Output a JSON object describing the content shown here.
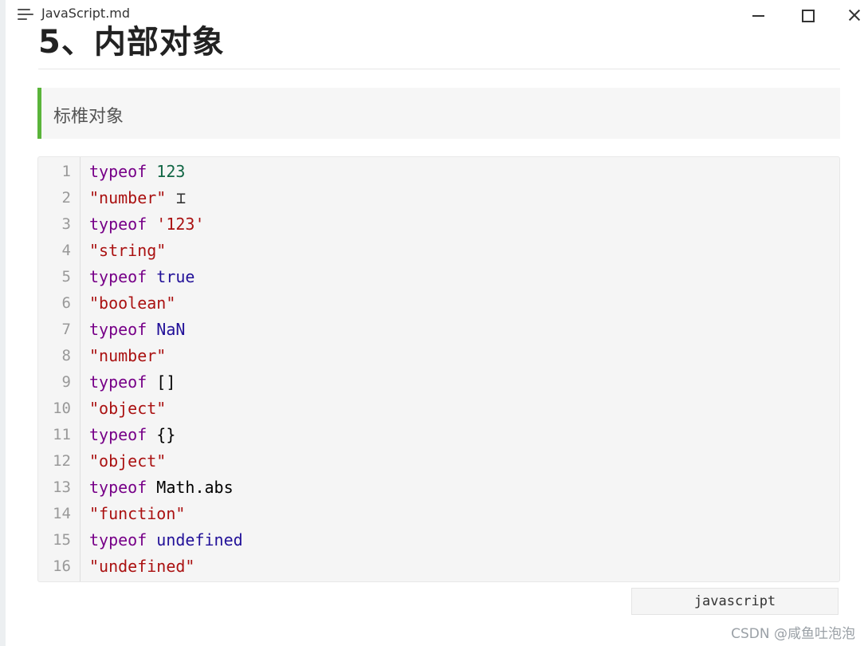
{
  "window": {
    "file_title": "JavaScript.md"
  },
  "document": {
    "heading": "5、内部对象",
    "blockquote": "标椎对象",
    "code_language": "javascript",
    "code_lines": [
      {
        "num": "1",
        "tokens": [
          {
            "t": "typeof",
            "c": "kw"
          },
          {
            "t": " "
          },
          {
            "t": "123",
            "c": "num"
          }
        ]
      },
      {
        "num": "2",
        "tokens": [
          {
            "t": "\"number\"",
            "c": "str"
          }
        ]
      },
      {
        "num": "3",
        "tokens": [
          {
            "t": "typeof",
            "c": "kw"
          },
          {
            "t": " "
          },
          {
            "t": "'123'",
            "c": "str"
          }
        ]
      },
      {
        "num": "4",
        "tokens": [
          {
            "t": "\"string\"",
            "c": "str"
          }
        ]
      },
      {
        "num": "5",
        "tokens": [
          {
            "t": "typeof",
            "c": "kw"
          },
          {
            "t": " "
          },
          {
            "t": "true",
            "c": "atom"
          }
        ]
      },
      {
        "num": "6",
        "tokens": [
          {
            "t": "\"boolean\"",
            "c": "str"
          }
        ]
      },
      {
        "num": "7",
        "tokens": [
          {
            "t": "typeof",
            "c": "kw"
          },
          {
            "t": " "
          },
          {
            "t": "NaN",
            "c": "atom"
          }
        ]
      },
      {
        "num": "8",
        "tokens": [
          {
            "t": "\"number\"",
            "c": "str"
          }
        ]
      },
      {
        "num": "9",
        "tokens": [
          {
            "t": "typeof",
            "c": "kw"
          },
          {
            "t": " "
          },
          {
            "t": "[]",
            "c": "var"
          }
        ]
      },
      {
        "num": "10",
        "tokens": [
          {
            "t": "\"object\"",
            "c": "str"
          }
        ]
      },
      {
        "num": "11",
        "tokens": [
          {
            "t": "typeof",
            "c": "kw"
          },
          {
            "t": " "
          },
          {
            "t": "{}",
            "c": "var"
          }
        ]
      },
      {
        "num": "12",
        "tokens": [
          {
            "t": "\"object\"",
            "c": "str"
          }
        ]
      },
      {
        "num": "13",
        "tokens": [
          {
            "t": "typeof",
            "c": "kw"
          },
          {
            "t": " "
          },
          {
            "t": "Math.abs",
            "c": "var"
          }
        ]
      },
      {
        "num": "14",
        "tokens": [
          {
            "t": "\"function\"",
            "c": "str"
          }
        ]
      },
      {
        "num": "15",
        "tokens": [
          {
            "t": "typeof",
            "c": "kw"
          },
          {
            "t": " "
          },
          {
            "t": "undefined",
            "c": "atom"
          }
        ]
      },
      {
        "num": "16",
        "tokens": [
          {
            "t": "\"undefined\"",
            "c": "str"
          }
        ]
      }
    ]
  },
  "watermark": "CSDN @咸鱼吐泡泡",
  "colors": {
    "quote_border": "#5ab43a",
    "keyword": "#770088",
    "string": "#aa1111",
    "number": "#116644",
    "atom": "#221199"
  }
}
